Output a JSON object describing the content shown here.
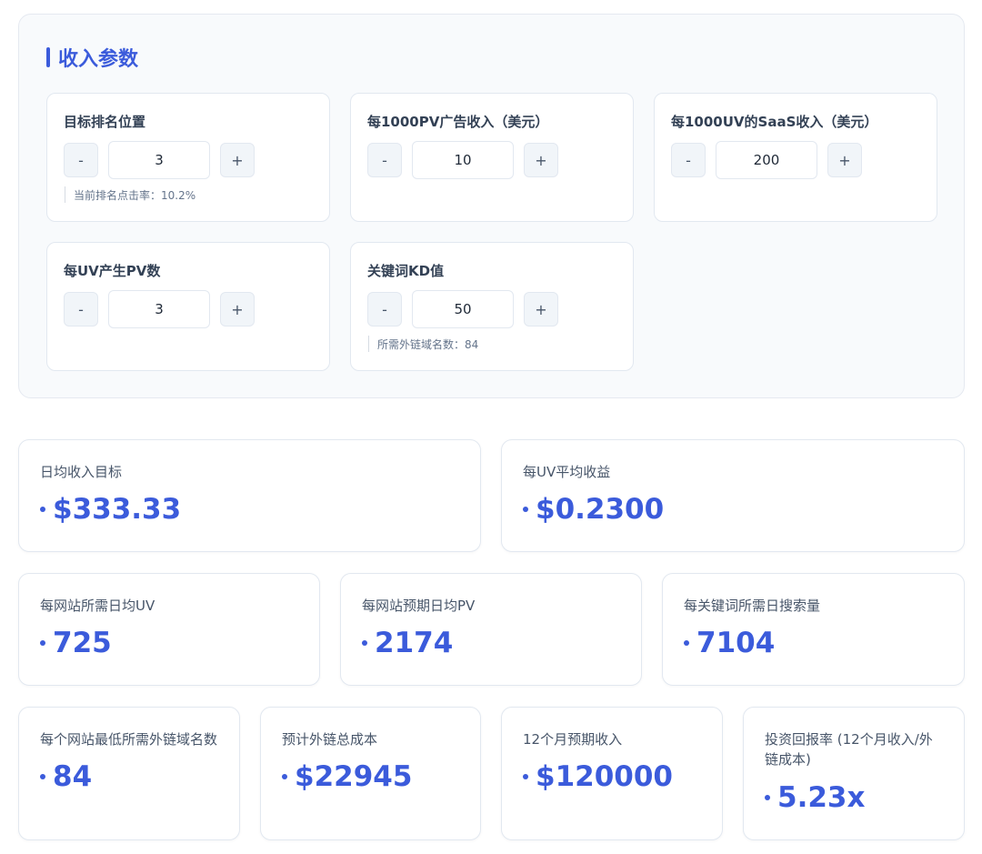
{
  "params_section": {
    "title": "收入参数",
    "cards": [
      {
        "label": "目标排名位置",
        "value": "3",
        "hint": "当前排名点击率：10.2%"
      },
      {
        "label": "每1000PV广告收入（美元）",
        "value": "10",
        "hint": ""
      },
      {
        "label": "每1000UV的SaaS收入（美元）",
        "value": "200",
        "hint": ""
      },
      {
        "label": "每UV产生PV数",
        "value": "3",
        "hint": ""
      },
      {
        "label": "关键词KD值",
        "value": "50",
        "hint": "所需外链域名数：84"
      }
    ],
    "minus_label": "-",
    "plus_label": "+"
  },
  "metrics": [
    {
      "label": "日均收入目标",
      "value": "$333.33"
    },
    {
      "label": "每UV平均收益",
      "value": "$0.2300"
    },
    {
      "label": "每网站所需日均UV",
      "value": "725"
    },
    {
      "label": "每网站预期日均PV",
      "value": "2174"
    },
    {
      "label": "每关键词所需日搜索量",
      "value": "7104"
    },
    {
      "label": "每个网站最低所需外链域名数",
      "value": "84"
    },
    {
      "label": "预计外链总成本",
      "value": "$22945"
    },
    {
      "label": "12个月预期收入",
      "value": "$120000"
    },
    {
      "label": "投资回报率 (12个月收入/外链成本)",
      "value": "5.23x"
    }
  ],
  "colors": {
    "accent": "#3b5bdb",
    "panel_bg": "#f8fafc",
    "border": "#e2e8f0"
  }
}
